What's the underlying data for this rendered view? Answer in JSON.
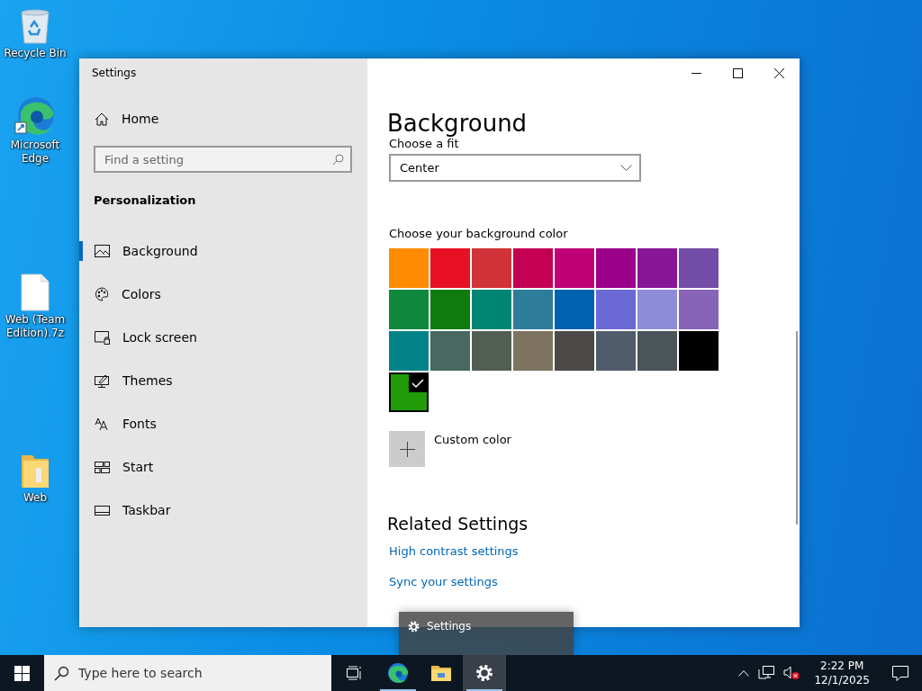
{
  "desktop_icons": [
    {
      "kind": "recycle",
      "label": "Recycle Bin"
    },
    {
      "kind": "edge",
      "label": "Microsoft Edge"
    },
    {
      "kind": "file",
      "label": "Web (Team Edition).7z"
    },
    {
      "kind": "folder",
      "label": "Web"
    }
  ],
  "window": {
    "title": "Settings",
    "sidebar": {
      "home": "Home",
      "search_placeholder": "Find a setting",
      "section": "Personalization",
      "items": [
        {
          "kind": "picture",
          "label": "Background",
          "selected": true
        },
        {
          "kind": "palette",
          "label": "Colors",
          "selected": false
        },
        {
          "kind": "lock",
          "label": "Lock screen",
          "selected": false
        },
        {
          "kind": "themes",
          "label": "Themes",
          "selected": false
        },
        {
          "kind": "fonts",
          "label": "Fonts",
          "selected": false
        },
        {
          "kind": "start",
          "label": "Start",
          "selected": false
        },
        {
          "kind": "taskbar",
          "label": "Taskbar",
          "selected": false
        }
      ]
    },
    "content": {
      "title": "Background",
      "fit_label": "Choose a fit",
      "fit_value": "Center",
      "color_label": "Choose your background color",
      "colors": [
        {
          "color": "#ff8c00",
          "selected": false
        },
        {
          "color": "#e81123",
          "selected": false
        },
        {
          "color": "#d13438",
          "selected": false
        },
        {
          "color": "#c30052",
          "selected": false
        },
        {
          "color": "#bf0077",
          "selected": false
        },
        {
          "color": "#9a0089",
          "selected": false
        },
        {
          "color": "#881798",
          "selected": false
        },
        {
          "color": "#744da9",
          "selected": false
        },
        {
          "color": "#10893e",
          "selected": false
        },
        {
          "color": "#107c10",
          "selected": false
        },
        {
          "color": "#018574",
          "selected": false
        },
        {
          "color": "#2d7d9a",
          "selected": false
        },
        {
          "color": "#0063b1",
          "selected": false
        },
        {
          "color": "#6b69d6",
          "selected": false
        },
        {
          "color": "#8e8cd8",
          "selected": false
        },
        {
          "color": "#8764b8",
          "selected": false
        },
        {
          "color": "#038387",
          "selected": false
        },
        {
          "color": "#486860",
          "selected": false
        },
        {
          "color": "#525e54",
          "selected": false
        },
        {
          "color": "#7e735f",
          "selected": false
        },
        {
          "color": "#4c4a48",
          "selected": false
        },
        {
          "color": "#515c6b",
          "selected": false
        },
        {
          "color": "#4a5459",
          "selected": false
        },
        {
          "color": "#000000",
          "selected": false
        },
        {
          "color": "#219c08",
          "selected": true
        }
      ],
      "custom_color": "Custom color",
      "related_title": "Related Settings",
      "links": [
        "High contrast settings",
        "Sync your settings"
      ]
    }
  },
  "thumbnail": {
    "title": "Settings"
  },
  "taskbar": {
    "search_placeholder": "Type here to search",
    "apps": [
      {
        "kind": "taskview",
        "selected": false,
        "running": false
      },
      {
        "kind": "edge",
        "selected": false,
        "running": true
      },
      {
        "kind": "explorer",
        "selected": false,
        "running": false
      },
      {
        "kind": "settings",
        "selected": true,
        "running": true
      }
    ],
    "time": "2:22 PM",
    "date": "12/1/2025"
  }
}
